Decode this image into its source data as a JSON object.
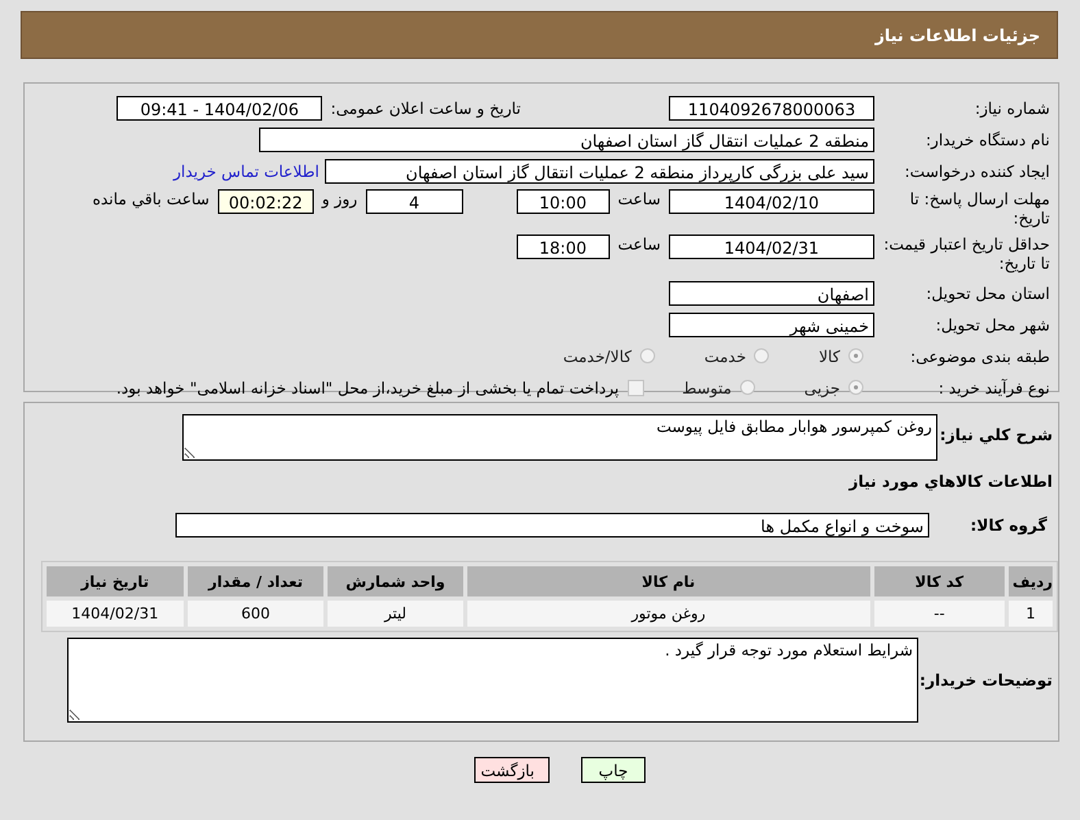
{
  "header": {
    "title": "جزئیات اطلاعات نیاز"
  },
  "need_number": {
    "label": "شماره نیاز:",
    "value": "1104092678000063"
  },
  "announce": {
    "label": "تاریخ و ساعت اعلان عمومی:",
    "value": "1404/02/06 - 09:41"
  },
  "buyer_org": {
    "label": "نام دستگاه خریدار:",
    "value": "منطقه 2 عملیات انتقال گاز استان اصفهان"
  },
  "requester": {
    "label": "ایجاد کننده درخواست:",
    "value": "سید علی بزرگی کارپرداز منطقه 2 عملیات انتقال گاز استان اصفهان",
    "contact_link": "اطلاعات تماس خریدار"
  },
  "response_deadline": {
    "label": "مهلت ارسال پاسخ: تا تاریخ:",
    "date": "1404/02/10",
    "time_label": "ساعت",
    "time": "10:00",
    "days": "4",
    "days_suffix": "روز و",
    "remaining": "00:02:22",
    "remaining_suffix": "ساعت باقي مانده"
  },
  "price_validity": {
    "label": "حداقل تاریخ اعتبار قیمت: تا تاریخ:",
    "date": "1404/02/31",
    "time_label": "ساعت",
    "time": "18:00"
  },
  "delivery_province": {
    "label": "استان محل تحویل:",
    "value": "اصفهان"
  },
  "delivery_city": {
    "label": "شهر محل تحویل:",
    "value": "خمینی شهر"
  },
  "category": {
    "label": "طبقه بندی موضوعی:",
    "options": [
      {
        "label": "کالا",
        "selected": true
      },
      {
        "label": "خدمت",
        "selected": false
      },
      {
        "label": "کالا/خدمت",
        "selected": false
      }
    ]
  },
  "purchase_process": {
    "label": "نوع فرآیند خرید :",
    "options": [
      {
        "label": "جزیی",
        "selected": true
      },
      {
        "label": "متوسط",
        "selected": false
      }
    ],
    "payment_note": {
      "checked": false,
      "text": "پرداخت تمام یا بخشی از مبلغ خرید،از محل \"اسناد خزانه اسلامی\" خواهد بود."
    }
  },
  "description": {
    "label": "شرح کلي نیاز:",
    "value": "روغن کمپرسور هوابار مطابق فایل پیوست"
  },
  "goods_heading": "اطلاعات کالاهاي مورد نیاز",
  "goods_group": {
    "label": "گروه کالا:",
    "value": "سوخت و انواع مکمل ها"
  },
  "table": {
    "columns": [
      "ردیف",
      "کد کالا",
      "نام کالا",
      "واحد شمارش",
      "تعداد / مقدار",
      "تاریخ نیاز"
    ],
    "rows": [
      [
        "1",
        "--",
        "روغن موتور",
        "لیتر",
        "600",
        "1404/02/31"
      ]
    ]
  },
  "buyer_notes": {
    "label": "توضیحات خریدار:",
    "value": "شرایط استعلام مورد توجه قرار گیرد ."
  },
  "buttons": [
    {
      "kind": "print",
      "label": "چاپ"
    },
    {
      "kind": "back",
      "label": "بازگشت"
    }
  ]
}
